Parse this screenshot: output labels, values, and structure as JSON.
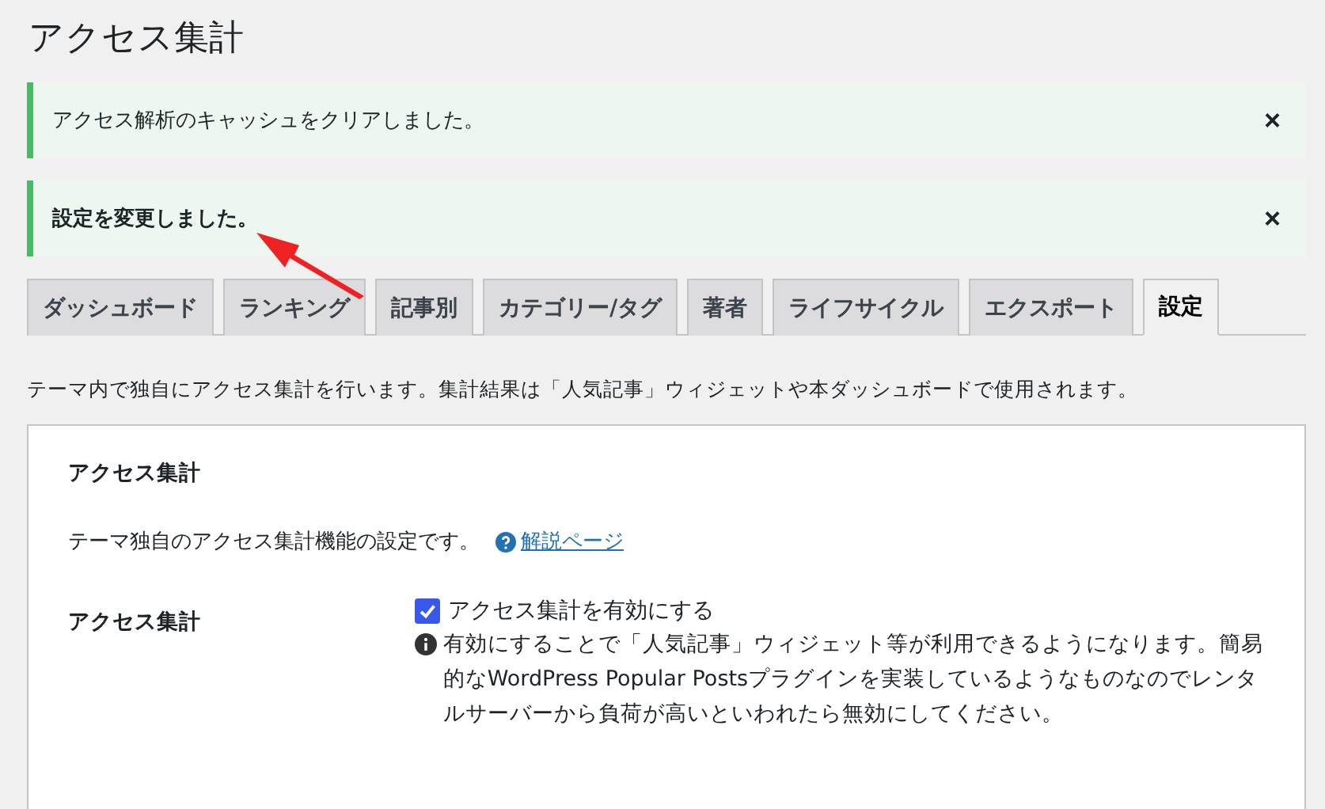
{
  "page_title": "アクセス集計",
  "notices": [
    {
      "message": "アクセス解析のキャッシュをクリアしました。",
      "bold": false,
      "dismiss": "×"
    },
    {
      "message": "設定を変更しました。",
      "bold": true,
      "dismiss": "×"
    }
  ],
  "annotation": {
    "kind": "arrow"
  },
  "tabs": [
    {
      "label": "ダッシュボード",
      "selected": false
    },
    {
      "label": "ランキング",
      "selected": false
    },
    {
      "label": "記事別",
      "selected": false
    },
    {
      "label": "カテゴリー/タグ",
      "selected": false
    },
    {
      "label": "著者",
      "selected": false
    },
    {
      "label": "ライフサイクル",
      "selected": false
    },
    {
      "label": "エクスポート",
      "selected": false
    },
    {
      "label": "設定",
      "selected": true
    }
  ],
  "description": "テーマ内で独自にアクセス集計を行います。集計結果は「人気記事」ウィジェットや本ダッシュボードで使用されます。",
  "panel": {
    "heading": "アクセス集計",
    "intro": "テーマ独自のアクセス集計機能の設定です。",
    "help_link": "解説ページ",
    "settings": [
      {
        "label": "アクセス集計",
        "checkbox_label": "アクセス集計を有効にする",
        "checked": true,
        "note": "有効にすることで「人気記事」ウィジェット等が利用できるようになります。簡易的なWordPress Popular Postsプラグインを実装しているようなものなのでレンタルサーバーから負荷が高いといわれたら無効にしてください。"
      }
    ]
  }
}
